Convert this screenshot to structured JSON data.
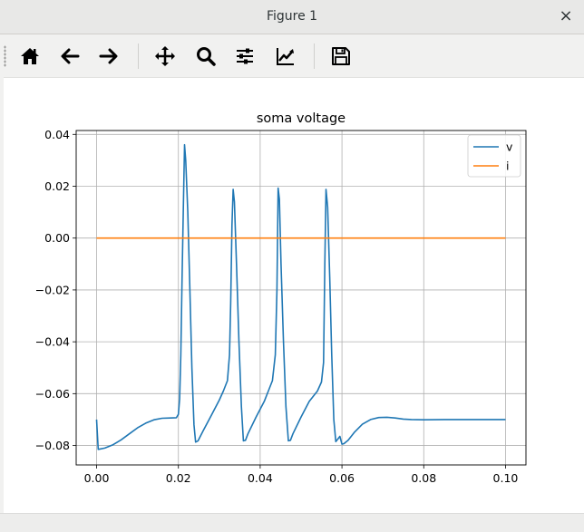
{
  "window": {
    "title": "Figure 1",
    "close_symbol": "×"
  },
  "toolbar": {
    "buttons": [
      {
        "name": "home-button",
        "icon": "home-icon"
      },
      {
        "name": "back-button",
        "icon": "arrow-left-icon"
      },
      {
        "name": "forward-button",
        "icon": "arrow-right-icon"
      },
      {
        "name": "pan-button",
        "icon": "move-icon"
      },
      {
        "name": "zoom-button",
        "icon": "magnifier-icon"
      },
      {
        "name": "configure-subplots-button",
        "icon": "sliders-icon"
      },
      {
        "name": "edit-axis-button",
        "icon": "line-chart-icon"
      },
      {
        "name": "save-button",
        "icon": "floppy-disk-icon"
      }
    ]
  },
  "colors": {
    "v": "#1f77b4",
    "i": "#ff7f0e",
    "grid": "#b0b0b0"
  },
  "chart_data": {
    "type": "line",
    "title": "soma voltage",
    "xlabel": "",
    "ylabel": "",
    "xlim": [
      -0.005,
      0.105
    ],
    "ylim": [
      -0.0875,
      0.0415
    ],
    "xticks": [
      0.0,
      0.02,
      0.04,
      0.06,
      0.08,
      0.1
    ],
    "xtick_labels": [
      "0.00",
      "0.02",
      "0.04",
      "0.06",
      "0.08",
      "0.10"
    ],
    "yticks": [
      0.04,
      0.02,
      0.0,
      -0.02,
      -0.04,
      -0.06,
      -0.08
    ],
    "ytick_labels": [
      "0.04",
      "0.02",
      "0.00",
      "−0.02",
      "−0.04",
      "−0.06",
      "−0.08"
    ],
    "grid": true,
    "legend": "upper-right",
    "series": [
      {
        "name": "v",
        "x": [
          0.0,
          0.0004,
          0.001,
          0.002,
          0.004,
          0.006,
          0.008,
          0.01,
          0.012,
          0.014,
          0.016,
          0.018,
          0.0195,
          0.02,
          0.0203,
          0.0206,
          0.0209,
          0.0212,
          0.0215,
          0.0218,
          0.0223,
          0.0228,
          0.0233,
          0.0238,
          0.0242,
          0.0248,
          0.026,
          0.028,
          0.03,
          0.031,
          0.032,
          0.0325,
          0.0328,
          0.0331,
          0.0334,
          0.0337,
          0.0342,
          0.0348,
          0.0354,
          0.0359,
          0.0364,
          0.037,
          0.039,
          0.041,
          0.042,
          0.043,
          0.0437,
          0.0441,
          0.0444,
          0.0447,
          0.0451,
          0.0457,
          0.0463,
          0.0469,
          0.0474,
          0.048,
          0.05,
          0.052,
          0.054,
          0.055,
          0.0555,
          0.0558,
          0.0561,
          0.0565,
          0.057,
          0.0575,
          0.058,
          0.0585,
          0.059,
          0.0595,
          0.06,
          0.0605,
          0.0615,
          0.063,
          0.065,
          0.067,
          0.069,
          0.071,
          0.073,
          0.075,
          0.077,
          0.08,
          0.085,
          0.09,
          0.095,
          0.1
        ],
        "y": [
          -0.07,
          -0.0815,
          -0.0813,
          -0.081,
          -0.0797,
          -0.0778,
          -0.0755,
          -0.0732,
          -0.0714,
          -0.0701,
          -0.0695,
          -0.0694,
          -0.0693,
          -0.068,
          -0.062,
          -0.045,
          -0.015,
          0.01,
          0.036,
          0.03,
          0.01,
          -0.02,
          -0.05,
          -0.072,
          -0.0787,
          -0.0782,
          -0.0745,
          -0.0685,
          -0.0625,
          -0.059,
          -0.055,
          -0.045,
          -0.025,
          0.005,
          0.0188,
          0.014,
          -0.01,
          -0.04,
          -0.065,
          -0.0782,
          -0.078,
          -0.0755,
          -0.069,
          -0.063,
          -0.059,
          -0.055,
          -0.045,
          -0.02,
          0.0193,
          0.015,
          -0.01,
          -0.04,
          -0.065,
          -0.0782,
          -0.078,
          -0.0755,
          -0.069,
          -0.063,
          -0.059,
          -0.0555,
          -0.048,
          -0.01,
          0.0188,
          0.012,
          -0.015,
          -0.045,
          -0.07,
          -0.0785,
          -0.0775,
          -0.0765,
          -0.0795,
          -0.0793,
          -0.078,
          -0.075,
          -0.0718,
          -0.07,
          -0.0692,
          -0.0691,
          -0.0694,
          -0.0698,
          -0.07,
          -0.0701,
          -0.07,
          -0.07,
          -0.07,
          -0.07
        ]
      },
      {
        "name": "i",
        "x": [
          0.0,
          0.1
        ],
        "y": [
          0.0,
          0.0
        ]
      }
    ]
  }
}
